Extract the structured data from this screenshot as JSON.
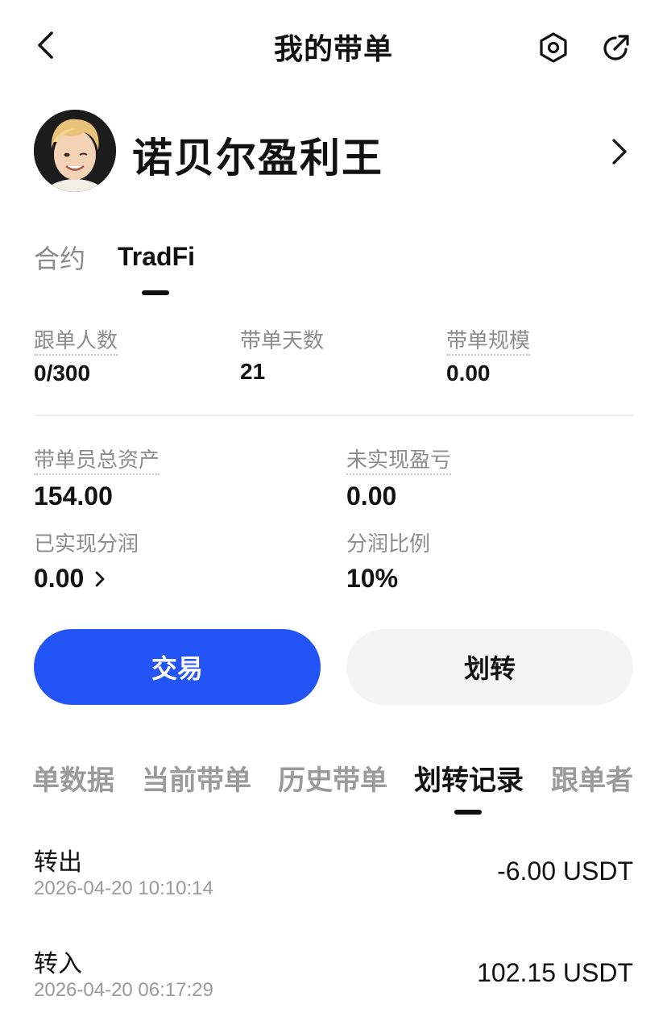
{
  "header": {
    "title": "我的带单",
    "icons": {
      "back": "chevron-left-icon",
      "settings": "hexagon-settings-icon",
      "share": "share-arrow-icon"
    }
  },
  "profile": {
    "name": "诺贝尔盈利王",
    "icons": {
      "avatar": "avatar-portrait",
      "chevron": "chevron-right-icon"
    }
  },
  "category_tabs": [
    {
      "label": "合约",
      "active": false
    },
    {
      "label": "TradFi",
      "active": true
    }
  ],
  "stats_row": [
    {
      "label": "跟单人数",
      "value": "0/300",
      "dotted": true
    },
    {
      "label": "带单天数",
      "value": "21",
      "dotted": false
    },
    {
      "label": "带单规模",
      "value": "0.00",
      "dotted": true
    }
  ],
  "assets": {
    "total_label": "带单员总资产",
    "total_value": "154.00",
    "unrealized_label": "未实现盈亏",
    "unrealized_value": "0.00",
    "realized_label": "已实现分润",
    "realized_value": "0.00",
    "ratio_label": "分润比例",
    "ratio_value": "10%"
  },
  "actions": {
    "trade_label": "交易",
    "transfer_label": "划转",
    "trade_color": "#2354f5"
  },
  "sub_tabs": [
    {
      "label": "单数据",
      "active": false
    },
    {
      "label": "当前带单",
      "active": false
    },
    {
      "label": "历史带单",
      "active": false
    },
    {
      "label": "划转记录",
      "active": true
    },
    {
      "label": "跟单者",
      "active": false
    }
  ],
  "records": [
    {
      "type": "转出",
      "time": "2026-04-20 10:10:14",
      "amount": "-6.00 USDT"
    },
    {
      "type": "转入",
      "time": "2026-04-20 06:17:29",
      "amount": "102.15 USDT"
    }
  ]
}
